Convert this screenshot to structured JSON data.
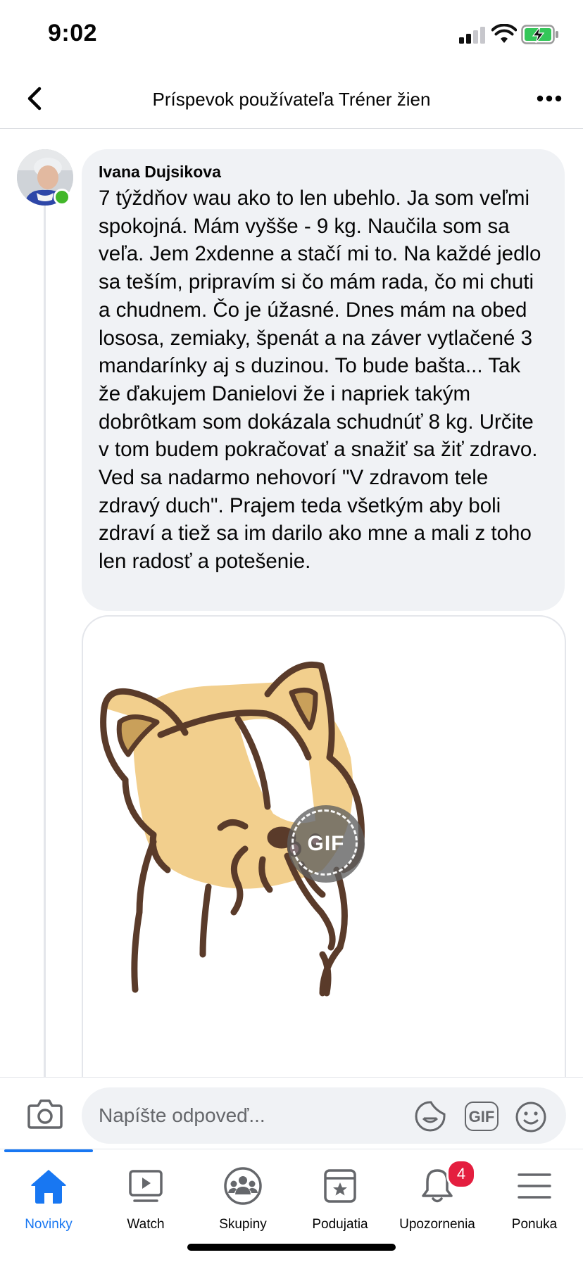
{
  "status_bar": {
    "time": "9:02"
  },
  "header": {
    "title": "Príspevok používateľa Tréner žien",
    "back_icon": "chevron-left-icon",
    "more_icon": "more-horizontal-icon"
  },
  "comment": {
    "author": "Ivana Dujsikova",
    "text": "7 týždňov wau ako to len ubehlo. Ja som veľmi spokojná. Mám vyšše - 9 kg. Naučila som sa veľa. Jem 2xdenne a stačí mi to. Na každé jedlo sa teším, pripravím si čo mám rada, čo mi chuti a chudnem. Čo je úžasné. Dnes mám na obed lososa, zemiaky, špenát a na záver vytlačené 3 mandarínky aj s duzinou. To bude bašta... Tak že ďakujem Danielovi že i napriek takým dobrôtkam som dokázala schudnúť 8 kg. Určite v tom budem pokračovať a snažiť sa žiť zdravo. Ved sa nadarmo nehovorí \"V zdravom tele zdravý duch\". Prajem teda všetkým aby boli zdraví a tiež sa im darilo ako mne a mali z toho len radosť a potešenie.",
    "online": true
  },
  "gif": {
    "badge_label": "GIF"
  },
  "composer": {
    "placeholder": "Napíšte odpoveď...",
    "gif_label": "GIF"
  },
  "tabs": [
    {
      "label": "Novinky",
      "icon": "home-icon",
      "active": true
    },
    {
      "label": "Watch",
      "icon": "watch-icon",
      "active": false
    },
    {
      "label": "Skupiny",
      "icon": "groups-icon",
      "active": false
    },
    {
      "label": "Podujatia",
      "icon": "events-icon",
      "active": false
    },
    {
      "label": "Upozornenia",
      "icon": "bell-icon",
      "active": false,
      "badge": "4"
    },
    {
      "label": "Ponuka",
      "icon": "menu-icon",
      "active": false
    }
  ],
  "colors": {
    "accent": "#1877f2",
    "bubble": "#f0f2f5",
    "online": "#42b72a",
    "badge": "#e41e3f"
  }
}
